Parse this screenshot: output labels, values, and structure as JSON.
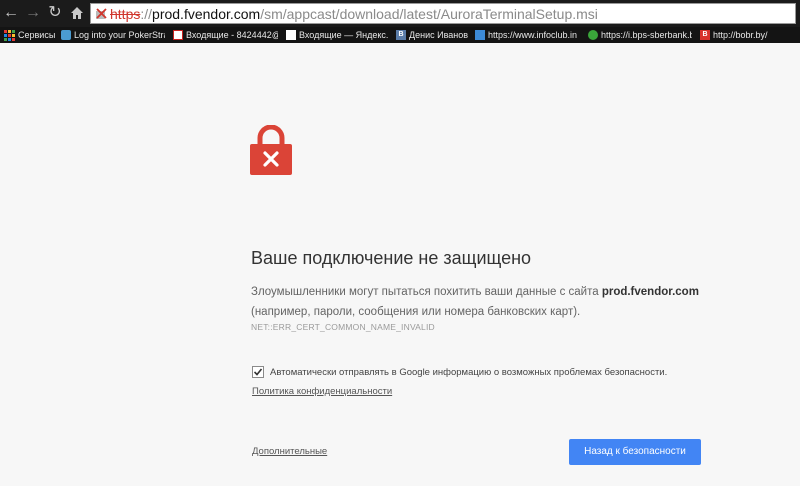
{
  "toolbar": {
    "url_scheme": "https",
    "url_sep": "://",
    "url_host": "prod.fvendor.com",
    "url_path": "/sm/appcast/download/latest/AuroraTerminalSetup.msi"
  },
  "bookmarks": [
    {
      "label": "Сервисы",
      "icon": "apps-grid-icon"
    },
    {
      "label": "Log into your PokerStrat",
      "icon": "pokerstrategy-icon"
    },
    {
      "label": "Входящие - 8424442@",
      "icon": "gmail-icon"
    },
    {
      "label": "Входящие — Яндекс.Г",
      "icon": "yandex-mail-icon"
    },
    {
      "label": "Денис Иванов",
      "icon": "vk-icon"
    },
    {
      "label": "https://www.infoclub.in",
      "icon": "infoclub-icon"
    },
    {
      "label": "https://i.bps-sberbank.b",
      "icon": "sberbank-icon"
    },
    {
      "label": "http://bobr.by/",
      "icon": "bobr-icon"
    }
  ],
  "page": {
    "title": "Ваше подключение не защищено",
    "desc_part1": "Злоумышленники могут пытаться похитить ваши данные с сайта ",
    "desc_host": "prod.fvendor.com",
    "desc_part2": " (например, пароли, сообщения или номера банковских карт).",
    "error_code": "NET::ERR_CERT_COMMON_NAME_INVALID",
    "checkbox_checked": true,
    "checkbox_label": "Автоматически отправлять в Google информацию о возможных проблемах безопасности.",
    "privacy_link": "Политика конфиденциальности",
    "advanced_link": "Дополнительные",
    "back_button": "Назад к безопасности"
  },
  "colors": {
    "accent": "#4285f4",
    "lock": "#db4437",
    "page_bg": "#f7f7f7"
  }
}
